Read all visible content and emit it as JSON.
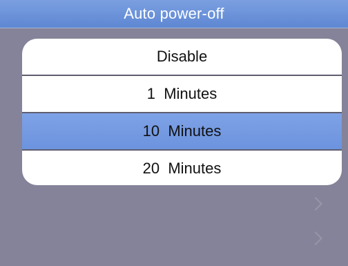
{
  "title": "Auto power-off",
  "menu": {
    "items": [
      {
        "label": "Disable",
        "selected": false
      },
      {
        "label": "1  Minutes",
        "selected": false
      },
      {
        "label": "10  Minutes",
        "selected": true
      },
      {
        "label": "20  Minutes",
        "selected": false
      }
    ]
  },
  "background_icons": [
    "chevron-right-icon",
    "chevron-right-icon"
  ],
  "colors": {
    "background": "#858399",
    "title_bar": "#6a91d9",
    "selection": "#78a0e4",
    "menu_bg": "#ffffff",
    "text": "#111111"
  }
}
